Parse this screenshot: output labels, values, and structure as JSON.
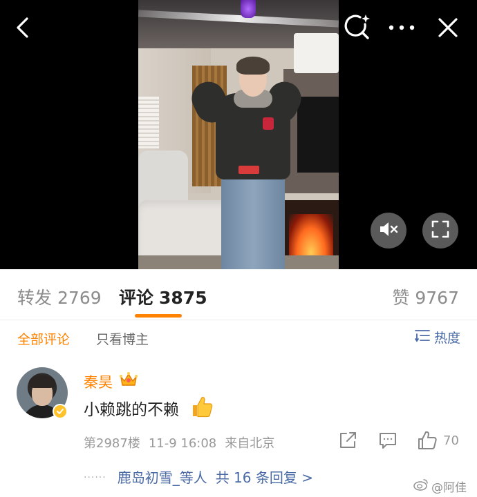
{
  "video": {
    "controls": {
      "back": "back-icon",
      "search": "lens-search-icon",
      "more": "more-icon",
      "close": "close-icon",
      "mute": "muted-speaker-icon",
      "fullscreen": "fullscreen-icon"
    }
  },
  "stats": {
    "repost_label": "转发",
    "repost_count": "2769",
    "comment_label": "评论",
    "comment_count": "3875",
    "like_label": "赞",
    "like_count": "9767",
    "active_tab": "评论",
    "accent_color": "#ff8200"
  },
  "filters": {
    "all": "全部评论",
    "author_only": "只看博主",
    "sort": "热度"
  },
  "comment": {
    "username": "秦昊",
    "text": "小赖跳的不赖",
    "emoji": "thumbs-up",
    "floor": "第2987楼",
    "date": "11-9 16:08",
    "location": "来自北京",
    "like_count": "70",
    "replies": {
      "names": "鹿岛初雪_",
      "suffix": "等人",
      "more": "共 16 条回复 >"
    }
  },
  "watermark": {
    "text": "@阿佳"
  }
}
